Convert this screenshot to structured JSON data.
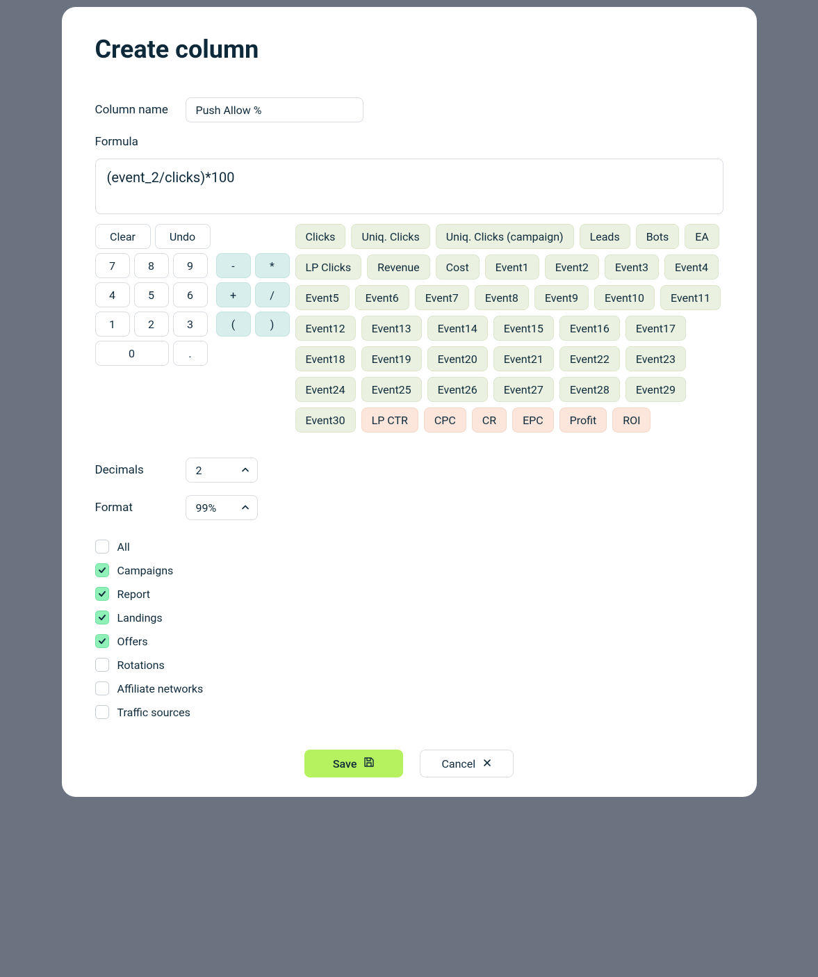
{
  "title": "Create column",
  "column_name_label": "Column name",
  "column_name_value": "Push Allow %",
  "formula_label": "Formula",
  "formula_value": "(event_2/clicks)*100",
  "actions": {
    "clear": "Clear",
    "undo": "Undo"
  },
  "numpad": [
    "7",
    "8",
    "9",
    "4",
    "5",
    "6",
    "1",
    "2",
    "3"
  ],
  "numpad_zero": "0",
  "numpad_dot": ".",
  "ops": [
    "-",
    "*",
    "+",
    "/",
    "(",
    ")"
  ],
  "tokens_green": [
    "Clicks",
    "Uniq. Clicks",
    "Uniq. Clicks (campaign)",
    "Leads",
    "Bots",
    "EA",
    "LP Clicks",
    "Revenue",
    "Cost",
    "Event1",
    "Event2",
    "Event3",
    "Event4",
    "Event5",
    "Event6",
    "Event7",
    "Event8",
    "Event9",
    "Event10",
    "Event11",
    "Event12",
    "Event13",
    "Event14",
    "Event15",
    "Event16",
    "Event17",
    "Event18",
    "Event19",
    "Event20",
    "Event21",
    "Event22",
    "Event23",
    "Event24",
    "Event25",
    "Event26",
    "Event27",
    "Event28",
    "Event29",
    "Event30"
  ],
  "tokens_orange": [
    "LP CTR",
    "CPC",
    "CR",
    "EPC",
    "Profit",
    "ROI"
  ],
  "decimals_label": "Decimals",
  "decimals_value": "2",
  "format_label": "Format",
  "format_value": "99%",
  "checks": [
    {
      "label": "All",
      "checked": false
    },
    {
      "label": "Campaigns",
      "checked": true
    },
    {
      "label": "Report",
      "checked": true
    },
    {
      "label": "Landings",
      "checked": true
    },
    {
      "label": "Offers",
      "checked": true
    },
    {
      "label": "Rotations",
      "checked": false
    },
    {
      "label": "Affiliate networks",
      "checked": false
    },
    {
      "label": "Traffic sources",
      "checked": false
    }
  ],
  "save_label": "Save",
  "cancel_label": "Cancel"
}
